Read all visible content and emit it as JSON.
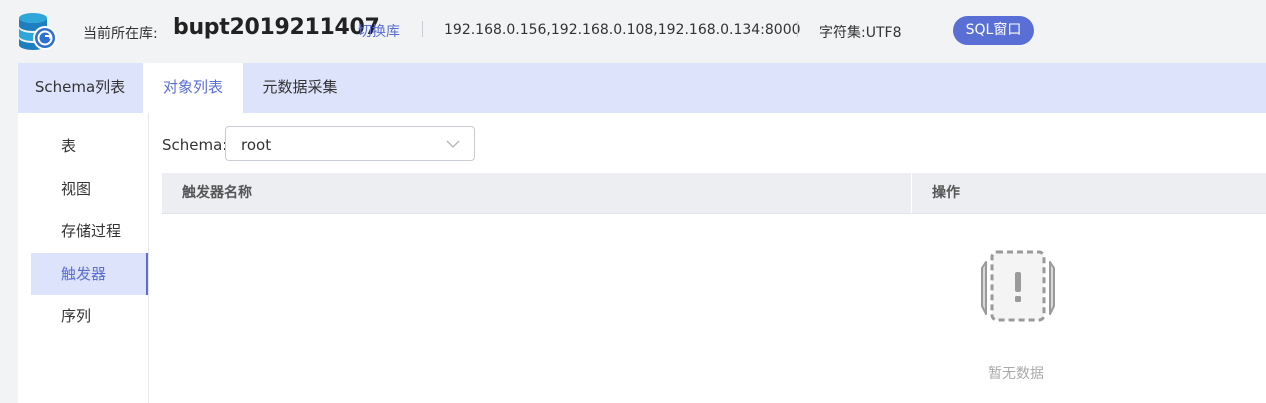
{
  "header": {
    "current_db_label": "当前所在库:",
    "db_name": "bupt2019211407",
    "switch_label": "切换库",
    "hosts": "192.168.0.156,192.168.0.108,192.168.0.134:8000",
    "charset": "字符集:UTF8",
    "sql_button": "SQL窗口"
  },
  "tabs": [
    {
      "label": "Schema列表",
      "active": false
    },
    {
      "label": "对象列表",
      "active": true
    },
    {
      "label": "元数据采集",
      "active": false
    }
  ],
  "side_nav": [
    {
      "label": "表",
      "active": false
    },
    {
      "label": "视图",
      "active": false
    },
    {
      "label": "存储过程",
      "active": false
    },
    {
      "label": "触发器",
      "active": true
    },
    {
      "label": "序列",
      "active": false
    }
  ],
  "schema_filter": {
    "label": "Schema:",
    "value": "root"
  },
  "table": {
    "columns": [
      "触发器名称",
      "操作"
    ],
    "rows": [],
    "empty_text": "暂无数据"
  },
  "colors": {
    "accent": "#5a6fd6",
    "tab_bar": "#dde3fb",
    "background": "#f2f3f5"
  },
  "icons": [
    "database-logo-icon",
    "chevron-down-icon",
    "empty-data-icon"
  ]
}
